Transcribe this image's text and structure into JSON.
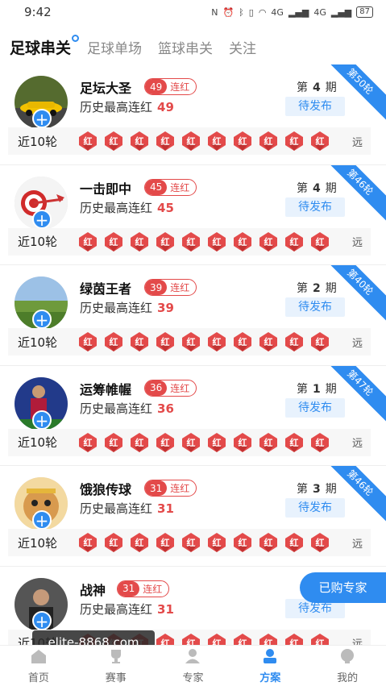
{
  "status": {
    "time": "9:42",
    "battery": "87",
    "net": "4G"
  },
  "tabs": [
    {
      "label": "足球串关",
      "active": true
    },
    {
      "label": "足球单场",
      "active": false
    },
    {
      "label": "篮球串关",
      "active": false
    },
    {
      "label": "关注",
      "active": false
    }
  ],
  "common": {
    "streak_label": "连红",
    "hist_label": "历史最高连红",
    "period_prefix": "第",
    "period_suffix": "期",
    "pending": "待发布",
    "recent_label": "近10轮",
    "badge_text": "红",
    "far_label": "远"
  },
  "experts": [
    {
      "name": "足坛大圣",
      "streak": "49",
      "hist": "49",
      "period": "4",
      "round": "第50轮",
      "avatar": "car-avatar"
    },
    {
      "name": "一击即中",
      "streak": "45",
      "hist": "45",
      "period": "4",
      "round": "第46轮",
      "avatar": "target-avatar"
    },
    {
      "name": "绿茵王者",
      "streak": "39",
      "hist": "39",
      "period": "2",
      "round": "第40轮",
      "avatar": "field-avatar"
    },
    {
      "name": "运筹帷幄",
      "streak": "36",
      "hist": "36",
      "period": "1",
      "round": "第47轮",
      "avatar": "player-avatar"
    },
    {
      "name": "饿狼传球",
      "streak": "31",
      "hist": "31",
      "period": "3",
      "round": "第46轮",
      "avatar": "monkey-avatar"
    },
    {
      "name": "战神",
      "streak": "31",
      "hist": "31",
      "period": "",
      "round": "",
      "avatar": "person-avatar"
    }
  ],
  "float_button": "已购专家",
  "watermark": "elite-8868.com",
  "nav": [
    {
      "label": "首页",
      "icon": "home-icon",
      "active": false
    },
    {
      "label": "赛事",
      "icon": "trophy-icon",
      "active": false
    },
    {
      "label": "专家",
      "icon": "expert-icon",
      "active": false
    },
    {
      "label": "方案",
      "icon": "plan-icon",
      "active": true
    },
    {
      "label": "我的",
      "icon": "profile-icon",
      "active": false
    }
  ],
  "colors": {
    "accent": "#2f8cf0",
    "red": "#e34a4a"
  }
}
